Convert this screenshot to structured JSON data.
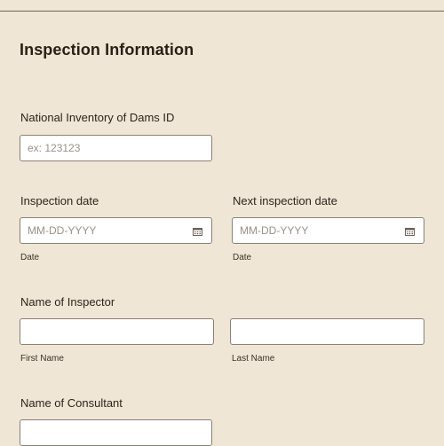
{
  "section": {
    "title": "Inspection Information"
  },
  "dam_id": {
    "label": "National Inventory of Dams ID",
    "placeholder": "ex: 123123"
  },
  "inspection_date": {
    "label": "Inspection date",
    "placeholder": "MM-DD-YYYY",
    "sublabel": "Date"
  },
  "next_inspection_date": {
    "label": "Next inspection date",
    "placeholder": "MM-DD-YYYY",
    "sublabel": "Date"
  },
  "inspector": {
    "label": "Name of Inspector",
    "first_name_sublabel": "First Name",
    "last_name_sublabel": "Last Name",
    "first_name_value": "",
    "last_name_value": ""
  },
  "consultant": {
    "label": "Name of Consultant",
    "value": ""
  },
  "icons": {
    "date_picker": "calendar-icon"
  },
  "colors": {
    "background": "#efe6d5",
    "field_border": "#8a8075",
    "text": "#2b2017",
    "placeholder": "#9a9187"
  }
}
